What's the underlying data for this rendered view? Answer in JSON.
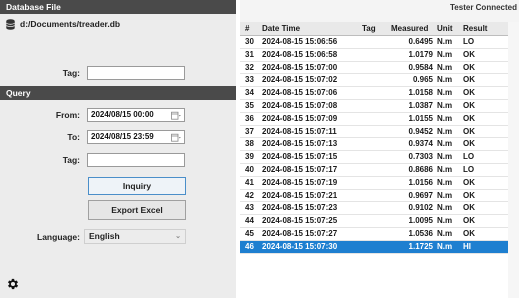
{
  "database": {
    "header": "Database File",
    "path": "d:/Documents/treader.db",
    "tag_label": "Tag:",
    "tag_value": ""
  },
  "query": {
    "header": "Query",
    "from_label": "From:",
    "from_value": "2024/08/15 00:00",
    "to_label": "To:",
    "to_value": "2024/08/15 23:59",
    "tag_label": "Tag:",
    "tag_value": "",
    "inquiry_label": "Inquiry",
    "export_label": "Export Excel",
    "language_label": "Language:",
    "language_value": "English"
  },
  "status": {
    "text": "Tester Connected"
  },
  "table": {
    "columns": [
      "#",
      "Date Time",
      "Tag",
      "Measured",
      "Unit",
      "Result"
    ],
    "rows": [
      {
        "num": "30",
        "datetime": "2024-08-15 15:06:56",
        "tag": "",
        "measured": "0.6495",
        "unit": "N.m",
        "result": "LO"
      },
      {
        "num": "31",
        "datetime": "2024-08-15 15:06:58",
        "tag": "",
        "measured": "1.0179",
        "unit": "N.m",
        "result": "OK"
      },
      {
        "num": "32",
        "datetime": "2024-08-15 15:07:00",
        "tag": "",
        "measured": "0.9584",
        "unit": "N.m",
        "result": "OK"
      },
      {
        "num": "33",
        "datetime": "2024-08-15 15:07:02",
        "tag": "",
        "measured": "0.965",
        "unit": "N.m",
        "result": "OK"
      },
      {
        "num": "34",
        "datetime": "2024-08-15 15:07:06",
        "tag": "",
        "measured": "1.0158",
        "unit": "N.m",
        "result": "OK"
      },
      {
        "num": "35",
        "datetime": "2024-08-15 15:07:08",
        "tag": "",
        "measured": "1.0387",
        "unit": "N.m",
        "result": "OK"
      },
      {
        "num": "36",
        "datetime": "2024-08-15 15:07:09",
        "tag": "",
        "measured": "1.0155",
        "unit": "N.m",
        "result": "OK"
      },
      {
        "num": "37",
        "datetime": "2024-08-15 15:07:11",
        "tag": "",
        "measured": "0.9452",
        "unit": "N.m",
        "result": "OK"
      },
      {
        "num": "38",
        "datetime": "2024-08-15 15:07:13",
        "tag": "",
        "measured": "0.9374",
        "unit": "N.m",
        "result": "OK"
      },
      {
        "num": "39",
        "datetime": "2024-08-15 15:07:15",
        "tag": "",
        "measured": "0.7303",
        "unit": "N.m",
        "result": "LO"
      },
      {
        "num": "40",
        "datetime": "2024-08-15 15:07:17",
        "tag": "",
        "measured": "0.8686",
        "unit": "N.m",
        "result": "LO"
      },
      {
        "num": "41",
        "datetime": "2024-08-15 15:07:19",
        "tag": "",
        "measured": "1.0156",
        "unit": "N.m",
        "result": "OK"
      },
      {
        "num": "42",
        "datetime": "2024-08-15 15:07:21",
        "tag": "",
        "measured": "0.9697",
        "unit": "N.m",
        "result": "OK"
      },
      {
        "num": "43",
        "datetime": "2024-08-15 15:07:23",
        "tag": "",
        "measured": "0.9102",
        "unit": "N.m",
        "result": "OK"
      },
      {
        "num": "44",
        "datetime": "2024-08-15 15:07:25",
        "tag": "",
        "measured": "1.0095",
        "unit": "N.m",
        "result": "OK"
      },
      {
        "num": "45",
        "datetime": "2024-08-15 15:07:27",
        "tag": "",
        "measured": "1.0536",
        "unit": "N.m",
        "result": "OK"
      },
      {
        "num": "46",
        "datetime": "2024-08-15 15:07:30",
        "tag": "",
        "measured": "1.1725",
        "unit": "N.m",
        "result": "HI"
      }
    ],
    "selected_num": "46"
  },
  "icons": {
    "database": "database-icon",
    "calendar": "calendar-icon",
    "settings": "gear-icon"
  },
  "colors": {
    "header_dark": "#4a4a4a",
    "selection": "#1e7fd0",
    "panel_bg": "#ececec"
  }
}
